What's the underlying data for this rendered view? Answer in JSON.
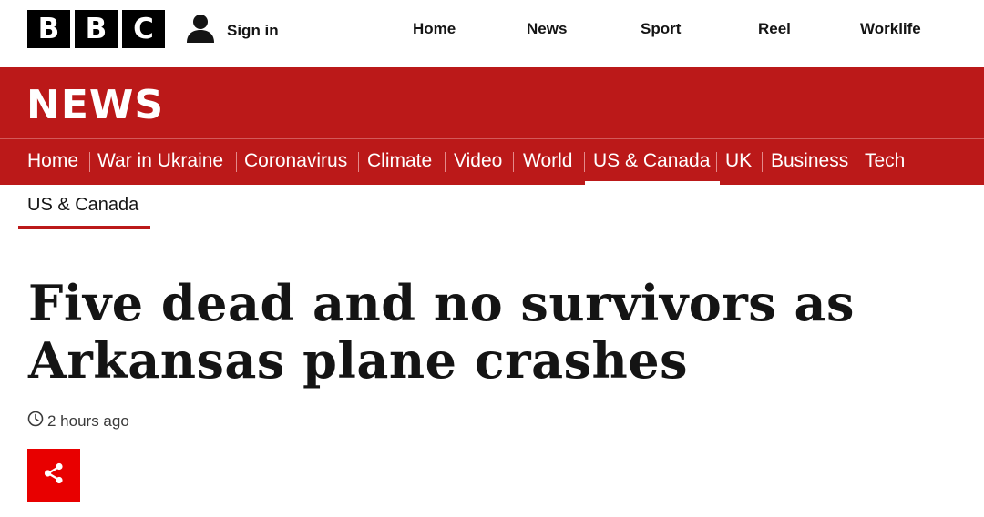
{
  "brand": {
    "logo_letters": [
      "B",
      "B",
      "C"
    ]
  },
  "account": {
    "signin_label": "Sign in"
  },
  "top_nav": [
    "Home",
    "News",
    "Sport",
    "Reel",
    "Worklife"
  ],
  "news_header": {
    "title": "NEWS"
  },
  "main_nav": {
    "items": [
      "Home",
      "War in Ukraine",
      "Coronavirus",
      "Climate",
      "Video",
      "World",
      "US & Canada",
      "UK",
      "Business",
      "Tech"
    ],
    "active": "US & Canada"
  },
  "section": {
    "label": "US & Canada"
  },
  "article": {
    "headline_line1": "Five dead and no survivors as",
    "headline_line2": "Arkansas plane crashes",
    "timestamp": "2 hours ago"
  },
  "colors": {
    "brand_red": "#bb1919",
    "share_red": "#e80000",
    "black": "#000000"
  },
  "icons": {
    "account": "user-icon",
    "clock": "clock-icon",
    "share": "share-icon"
  }
}
